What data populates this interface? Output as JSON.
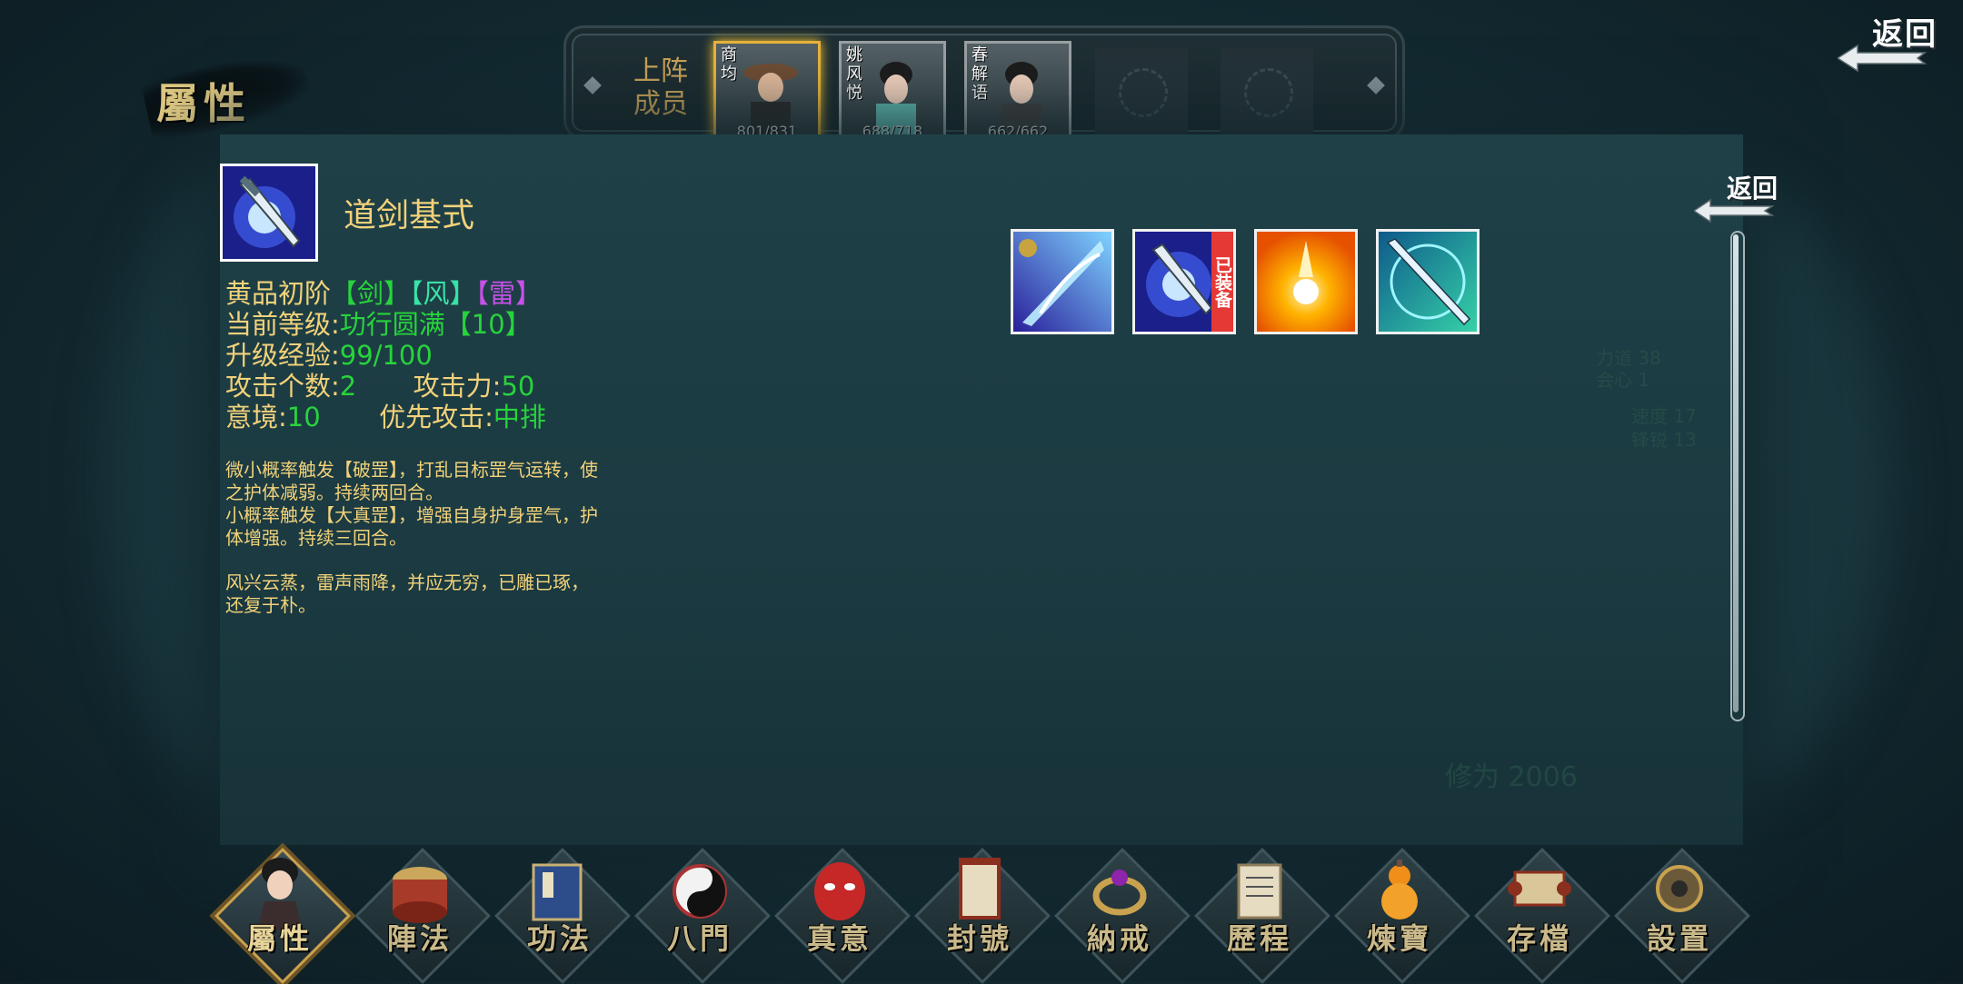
{
  "section_title": "屬性",
  "return_label": "返回",
  "party": {
    "label_line1": "上阵",
    "label_line2": "成员",
    "members": [
      {
        "name": "商均",
        "hp": "801/831",
        "active": true
      },
      {
        "name": "姚风悦",
        "hp": "688/718",
        "active": false
      },
      {
        "name": "春解语",
        "hp": "662/662",
        "active": false
      }
    ],
    "empty_slots": 2
  },
  "skill": {
    "name": "道剑基式",
    "grade": "黄品初阶",
    "tag_sword": "【剑】",
    "tag_wind": "【风】",
    "tag_thunder": "【雷】",
    "level_label": "当前等级:",
    "level_value": "功行圆满【10】",
    "exp_label": "升级经验:",
    "exp_value": "99/100",
    "attack_count_label": "攻击个数:",
    "attack_count_value": "2",
    "attack_power_label": "攻击力:",
    "attack_power_value": "50",
    "intent_label": "意境:",
    "intent_value": "10",
    "priority_label": "优先攻击:",
    "priority_value": "中排",
    "desc1": "微小概率触发【破罡】，打乱目标罡气运转，使之护体减弱。持续两回合。",
    "desc2": "小概率触发【大真罡】，增强自身护身罡气，护体增强。持续三回合。",
    "flavor": "风兴云蒸，雷声雨降，并应无穷，已雕已琢，还复于朴。"
  },
  "skill_list": {
    "equipped_tag": "已装备"
  },
  "inner_return_label": "返回",
  "nav": [
    {
      "label": "屬性",
      "icon": "character-icon"
    },
    {
      "label": "陣法",
      "icon": "drum-icon"
    },
    {
      "label": "功法",
      "icon": "book-icon"
    },
    {
      "label": "八門",
      "icon": "yin-yang-icon"
    },
    {
      "label": "真意",
      "icon": "mask-icon"
    },
    {
      "label": "封號",
      "icon": "banner-icon"
    },
    {
      "label": "納戒",
      "icon": "ring-icon"
    },
    {
      "label": "歷程",
      "icon": "scroll-icon"
    },
    {
      "label": "煉寶",
      "icon": "gourd-icon"
    },
    {
      "label": "存檔",
      "icon": "save-scroll-icon"
    },
    {
      "label": "設置",
      "icon": "gear-icon"
    }
  ],
  "colors": {
    "gold_text": "#f2d27a",
    "green_value": "#27d33c",
    "wind_cyan": "#37e3a6",
    "thunder_purple": "#c651e8",
    "equipped_red": "#e53935"
  }
}
